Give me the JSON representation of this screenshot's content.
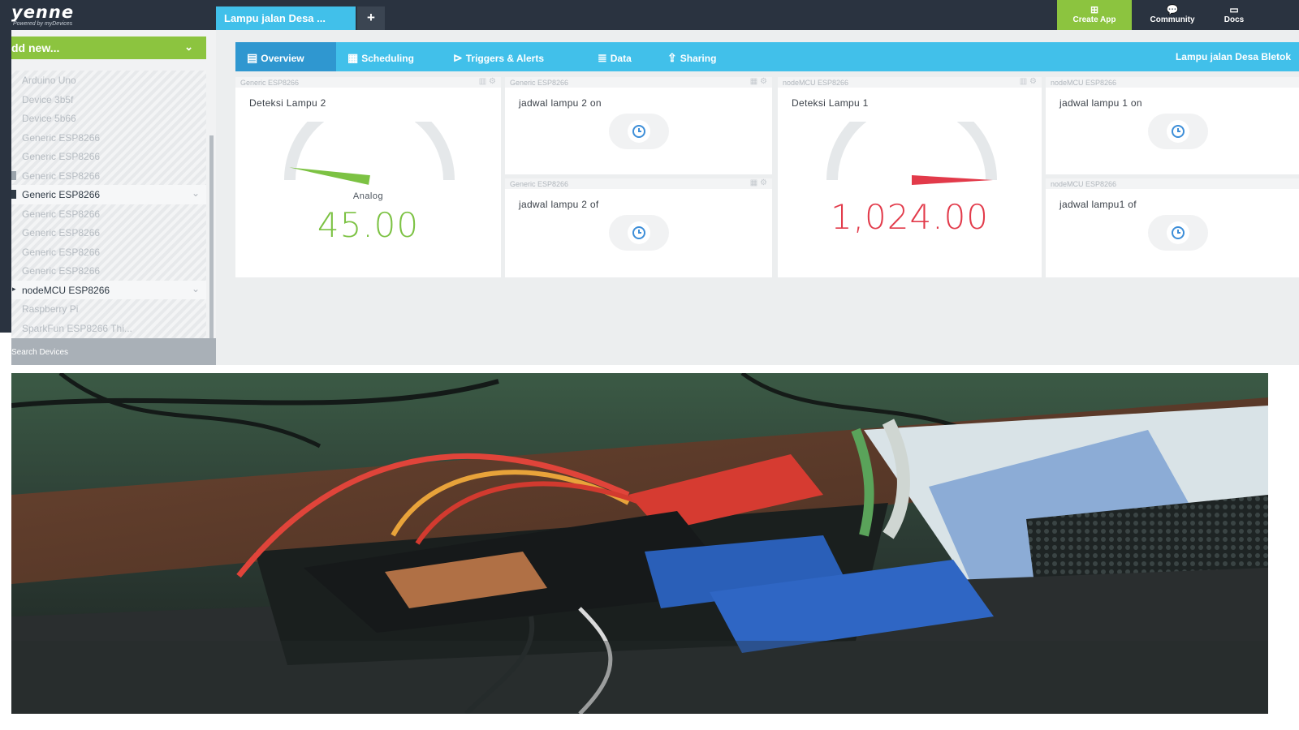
{
  "app": {
    "logo_name": "yenne",
    "logo_sub": "Powered by myDevices",
    "active_tab": "Lampu jalan Desa ...",
    "add_tab": "+",
    "nav": {
      "create_app": "Create App",
      "community": "Community",
      "docs": "Docs"
    }
  },
  "sidebar": {
    "add_new": "dd new...",
    "devices": [
      {
        "label": "Arduino Uno",
        "state": "dim"
      },
      {
        "label": "Device 3b5f",
        "state": "dim"
      },
      {
        "label": "Device 5b66",
        "state": "dim"
      },
      {
        "label": "Generic ESP8266",
        "state": "dim"
      },
      {
        "label": "Generic ESP8266",
        "state": "dim"
      },
      {
        "label": "Generic ESP8266",
        "state": "marked"
      },
      {
        "label": "Generic ESP8266",
        "state": "active"
      },
      {
        "label": "Generic ESP8266",
        "state": "dim"
      },
      {
        "label": "Generic ESP8266",
        "state": "dim"
      },
      {
        "label": "Generic ESP8266",
        "state": "dim"
      },
      {
        "label": "Generic ESP8266",
        "state": "dim"
      },
      {
        "label": "nodeMCU ESP8266",
        "state": "active"
      },
      {
        "label": "Raspberry Pi",
        "state": "dim"
      },
      {
        "label": "SparkFun ESP8266 Thi...",
        "state": "dim"
      }
    ],
    "search": "Search Devices"
  },
  "dashboard": {
    "tabs": {
      "overview": "Overview",
      "scheduling": "Scheduling",
      "triggers": "Triggers & Alerts",
      "data": "Data",
      "sharing": "Sharing"
    },
    "project_title": "Lampu jalan Desa Bletok",
    "widgets": {
      "gauge1": {
        "device": "Generic ESP8266",
        "title": "Deteksi Lampu 2",
        "label": "Analog",
        "value": "45.00",
        "level": 0.05,
        "color": "#7cc243"
      },
      "sched1": {
        "device": "Generic ESP8266",
        "title": "jadwal lampu 2 on"
      },
      "sched2": {
        "device": "Generic ESP8266",
        "title": "jadwal lampu 2 of"
      },
      "gauge2": {
        "device": "nodeMCU ESP8266",
        "title": "Deteksi Lampu 1",
        "value": "1,024.00",
        "level": 1.0,
        "color": "#e23a4a"
      },
      "sched3": {
        "device": "nodeMCU ESP8266",
        "title": "jadwal lampu 1 on"
      },
      "sched4": {
        "device": "nodeMCU ESP8266",
        "title": "jadwal lampu1 of"
      }
    }
  },
  "colors": {
    "topbar": "#2a3340",
    "accent_blue": "#41c0ea",
    "accent_green": "#8cc43f",
    "gauge_green": "#7cc243",
    "gauge_red": "#e23a4a",
    "clock_blue": "#3d8ed8"
  }
}
